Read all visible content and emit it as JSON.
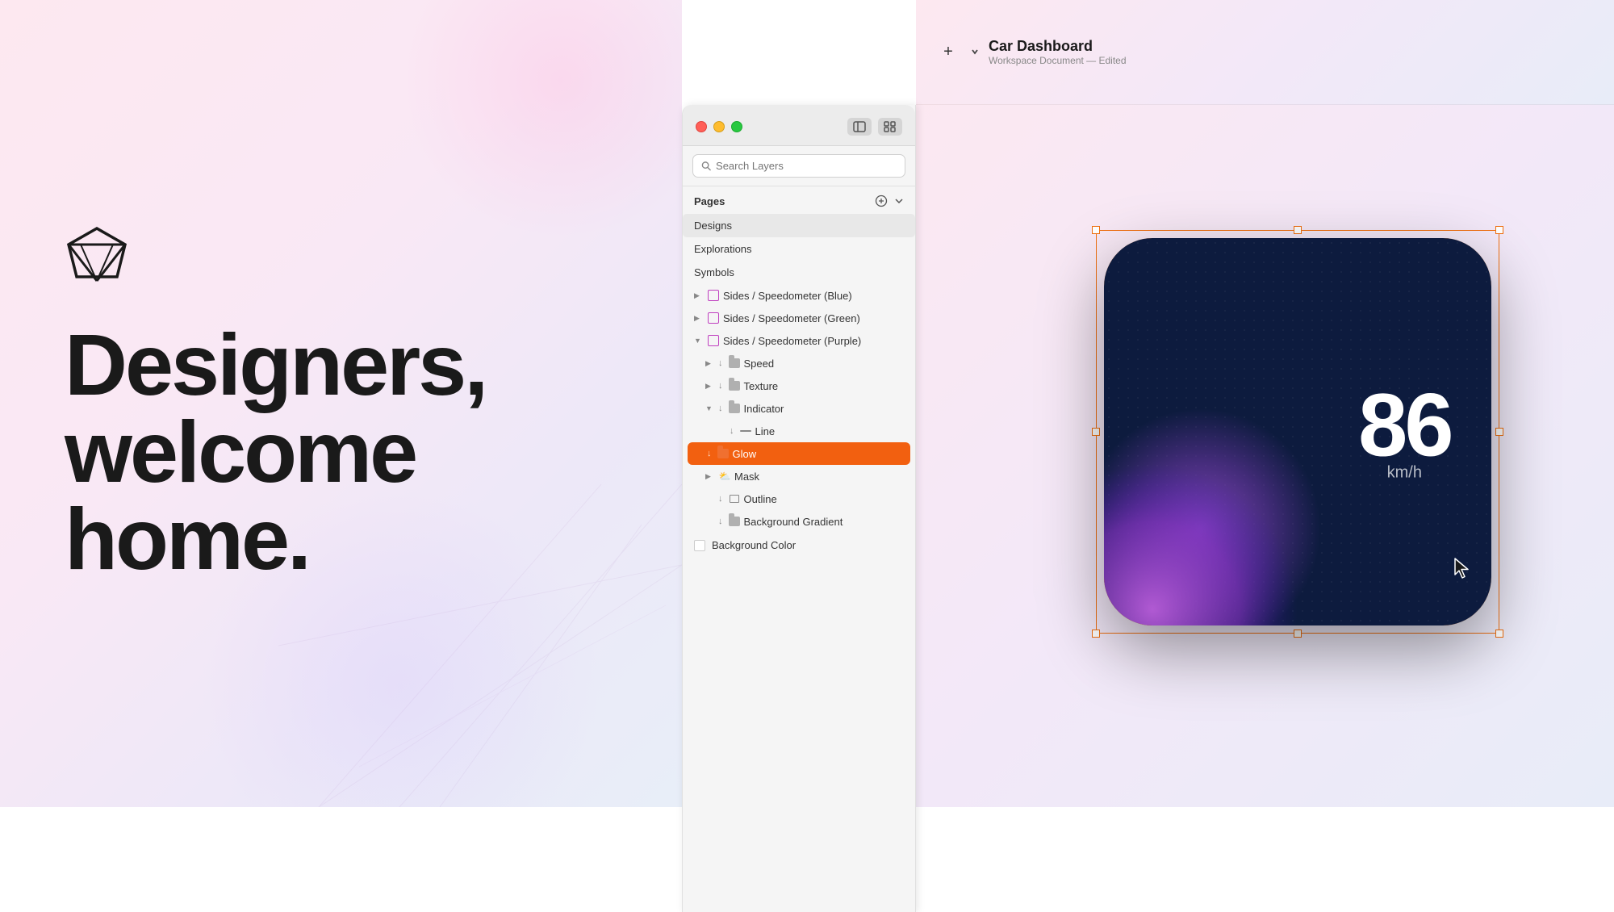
{
  "left": {
    "welcome_line1": "Designers,",
    "welcome_line2": "welcome",
    "welcome_line3": "home."
  },
  "middle": {
    "search_placeholder": "Search Layers",
    "pages_label": "Pages",
    "pages": [
      {
        "name": "Designs",
        "active": true
      },
      {
        "name": "Explorations",
        "active": false
      },
      {
        "name": "Symbols",
        "active": false
      }
    ],
    "layers": [
      {
        "label": "Sides / Speedometer (Blue)",
        "depth": 0,
        "expanded": false,
        "icon": "artboard"
      },
      {
        "label": "Sides / Speedometer (Green)",
        "depth": 0,
        "expanded": false,
        "icon": "artboard"
      },
      {
        "label": "Sides / Speedometer (Purple)",
        "depth": 0,
        "expanded": true,
        "icon": "artboard"
      },
      {
        "label": "Speed",
        "depth": 1,
        "expanded": false,
        "icon": "folder"
      },
      {
        "label": "Texture",
        "depth": 1,
        "expanded": false,
        "icon": "folder"
      },
      {
        "label": "Indicator",
        "depth": 1,
        "expanded": true,
        "icon": "folder"
      },
      {
        "label": "Line",
        "depth": 2,
        "expanded": false,
        "icon": "line"
      },
      {
        "label": "Glow",
        "depth": 2,
        "selected": true,
        "icon": "folder-orange"
      },
      {
        "label": "Mask",
        "depth": 1,
        "expanded": false,
        "icon": "cloud"
      },
      {
        "label": "Outline",
        "depth": 1,
        "expanded": false,
        "icon": "rect"
      },
      {
        "label": "Background Gradient",
        "depth": 1,
        "expanded": false,
        "icon": "folder"
      },
      {
        "label": "Background Color",
        "depth": 1,
        "expanded": false,
        "icon": "bg-color"
      }
    ]
  },
  "right": {
    "doc_title": "Car Dashboard",
    "doc_subtitle": "Workspace Document — Edited",
    "add_button": "+",
    "speed_value": "86",
    "speed_unit": "km/h"
  }
}
